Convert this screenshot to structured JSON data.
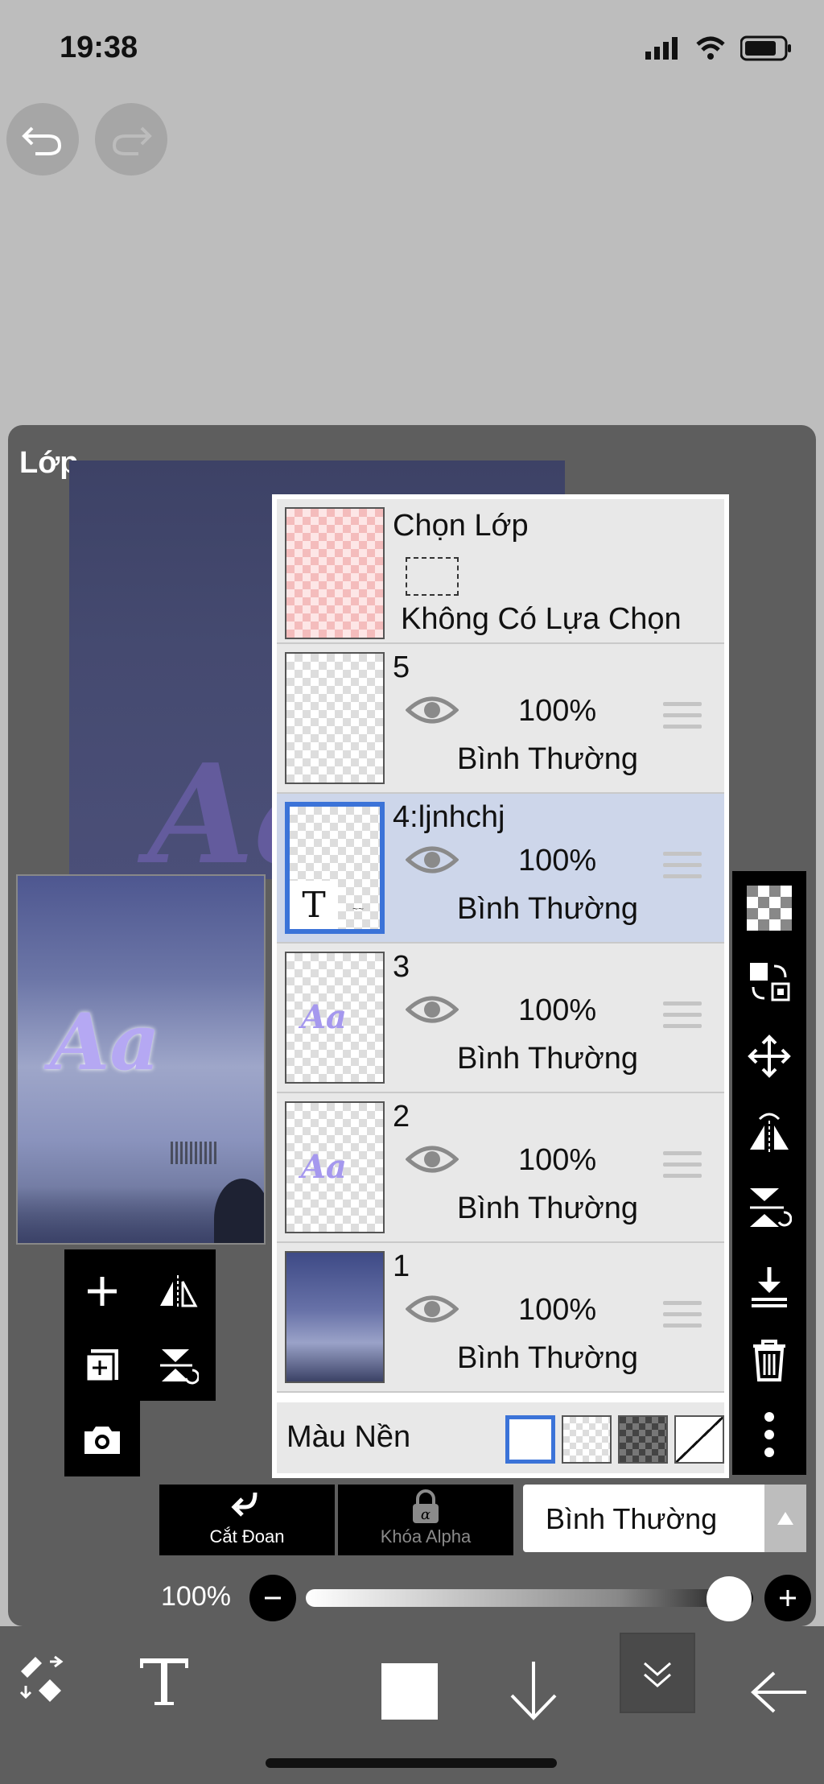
{
  "status": {
    "time": "19:38"
  },
  "panel": {
    "title": "Lớp"
  },
  "selection_layer": {
    "title": "Chọn Lớp",
    "subtitle": "Không Có Lựa Chọn"
  },
  "layers": [
    {
      "name": "5",
      "opacity": "100%",
      "blend": "Bình Thường",
      "selected": false
    },
    {
      "name": "4:ljnhchj",
      "opacity": "100%",
      "blend": "Bình Thường",
      "selected": true
    },
    {
      "name": "3",
      "opacity": "100%",
      "blend": "Bình Thường",
      "selected": false
    },
    {
      "name": "2",
      "opacity": "100%",
      "blend": "Bình Thường",
      "selected": false
    },
    {
      "name": "1",
      "opacity": "100%",
      "blend": "Bình Thường",
      "selected": false
    }
  ],
  "background_color": {
    "label": "Màu Nền"
  },
  "thumb_text": {
    "aa": "Aa",
    "t": "T"
  },
  "controls": {
    "clipping_label": "Cắt Đoan",
    "alpha_lock_label": "Khóa Alpha",
    "blend_mode": "Bình Thường",
    "opacity_value": "100%",
    "opacity_level": 1.0
  },
  "colors": {
    "accent": "#3b73d8",
    "panel": "#5e5e5e",
    "active_row": "#cdd6ea"
  },
  "icons": [
    "undo-icon",
    "redo-icon",
    "add-layer-icon",
    "flip-horizontal-icon",
    "duplicate-layer-icon",
    "merge-down-icon",
    "camera-icon",
    "checker-icon",
    "swap-icon",
    "move-icon",
    "flip-icon",
    "rotate-icon",
    "download-icon",
    "trash-icon",
    "more-icon",
    "eraser-swap-icon",
    "text-tool-icon",
    "color-swatch-icon",
    "arrow-down-icon",
    "double-chevron-icon",
    "back-arrow-icon"
  ]
}
